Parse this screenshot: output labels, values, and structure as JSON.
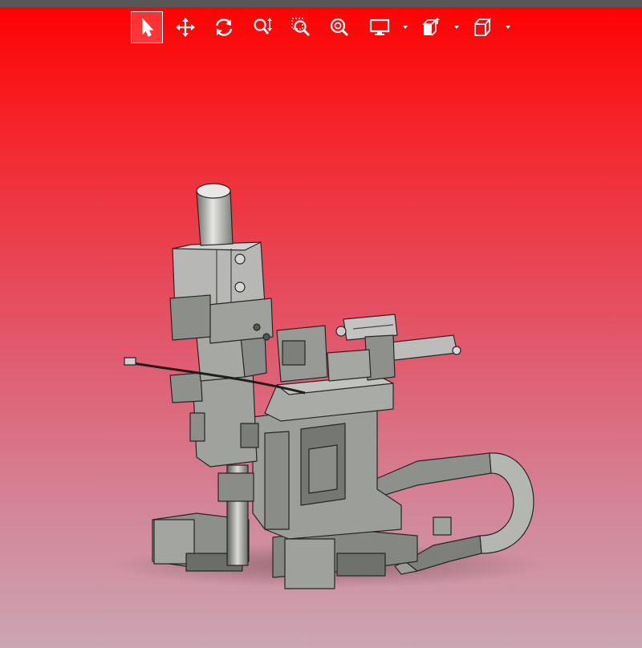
{
  "toolbar": {
    "buttons": [
      {
        "name": "select",
        "icon": "cursor-arrow-icon",
        "active": true
      },
      {
        "name": "pan",
        "icon": "move-arrows-icon",
        "active": false
      },
      {
        "name": "rotate",
        "icon": "rotate-icon",
        "active": false
      },
      {
        "name": "zoom",
        "icon": "zoom-updown-icon",
        "active": false
      },
      {
        "name": "zoom-window",
        "icon": "zoom-window-icon",
        "active": false
      },
      {
        "name": "zoom-fit",
        "icon": "zoom-fit-icon",
        "active": false
      },
      {
        "name": "display-mode",
        "icon": "monitor-icon",
        "active": false,
        "dropdown": true
      },
      {
        "name": "section-view",
        "icon": "section-box-icon",
        "active": false,
        "dropdown": true
      },
      {
        "name": "standard-views",
        "icon": "cube-view-icon",
        "active": false,
        "dropdown": true
      }
    ]
  },
  "viewport": {
    "background_top": "#ff0000",
    "background_bottom": "#cba5b2",
    "model": "cad-assembly-3d-model"
  },
  "colors": {
    "part_fill": "#9a9c98",
    "part_dark": "#676965",
    "part_light": "#c7c8c5",
    "edge": "#262626"
  }
}
